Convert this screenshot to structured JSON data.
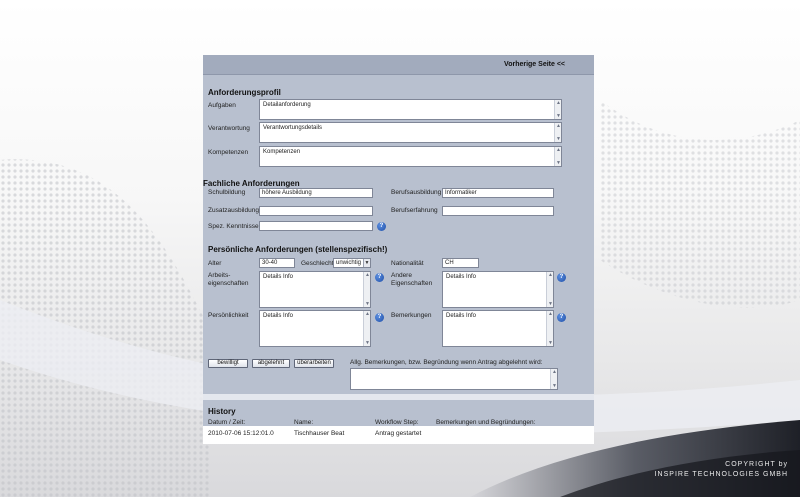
{
  "header": {
    "prev_link": "Vorherige Seite <<"
  },
  "anforderungsprofil": {
    "title": "Anforderungsprofil",
    "fields": [
      {
        "label": "Aufgaben",
        "value": "Detailanforderung"
      },
      {
        "label": "Verantwortung",
        "value": "Verantwortungsdetails"
      },
      {
        "label": "Kompetenzen",
        "value": "Kompetenzen"
      }
    ]
  },
  "fachliche": {
    "title": "Fachliche Anforderungen",
    "schulbildung": {
      "label": "Schulbildung",
      "value": "höhere Ausbildung"
    },
    "berufsausbildung": {
      "label": "Berufsausbildung",
      "value": "Informatiker"
    },
    "zusatzausbildung": {
      "label": "Zusatzausbildung",
      "value": ""
    },
    "berufserfahrung": {
      "label": "Berufserfahrung",
      "value": ""
    },
    "kenntnisse": {
      "label": "Spez. Kenntnisse",
      "value": ""
    }
  },
  "persoenliche": {
    "title": "Persönliche Anforderungen (stellenspezifisch!)",
    "alter": {
      "label": "Alter",
      "value": "30-40"
    },
    "geschlecht": {
      "label": "Geschlecht",
      "value": "unwichtig"
    },
    "nationalitaet": {
      "label": "Nationalität",
      "value": "CH"
    },
    "arbeitseigenschaften": {
      "label_line1": "Arbeits-",
      "label_line2": "eigenschaften",
      "value": "Details Info"
    },
    "andere": {
      "label_line1": "Andere",
      "label_line2": "Eigenschaften",
      "value": "Details Info"
    },
    "persoenlichkeit": {
      "label": "Persönlichkeit",
      "value": "Details Info"
    },
    "bemerkungen": {
      "label": "Bemerkungen",
      "value": "Details Info"
    }
  },
  "actions": {
    "approve": "bewilligt",
    "reject": "abgelehnt",
    "revise": "überarbeiten",
    "comment_label": "Allg. Bemerkungen, bzw. Begründung wenn Antrag abgelehnt wird:",
    "comment_value": ""
  },
  "history": {
    "title": "History",
    "columns": [
      "Datum / Zeit:",
      "Name:",
      "Workflow Step:",
      "Bemerkungen und Begründungen:"
    ],
    "rows": [
      [
        "2010-07-06 15:12:01.0",
        "Tischhauser Beat",
        "Antrag gestartet",
        ""
      ]
    ]
  },
  "footer": {
    "line1": "COPYRIGHT by",
    "line2": "INSPIRE TECHNOLOGIES GMBH"
  },
  "colors": {
    "panel": "#b8c0cf",
    "topbar": "#a2abbd",
    "help_icon": "#2a5fc0"
  }
}
